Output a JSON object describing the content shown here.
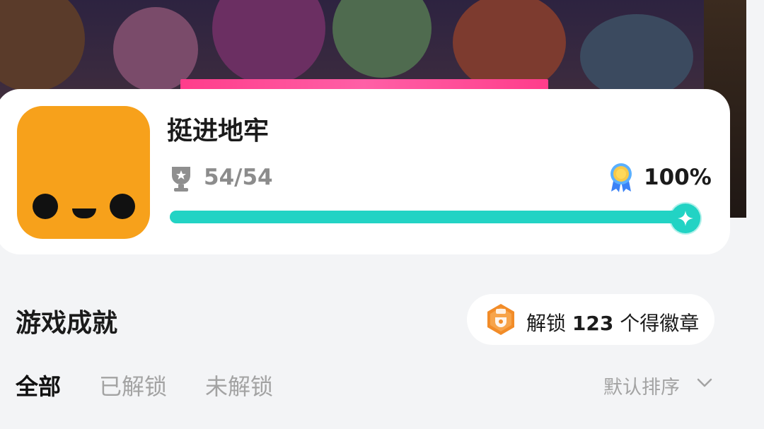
{
  "game": {
    "title": "挺进地牢",
    "achievements_progress": "54/54",
    "completion_percent": "100%",
    "completion_fraction": 1.0
  },
  "section": {
    "title": "游戏成就",
    "badge": {
      "prefix": "解锁",
      "count": "123",
      "suffix": "个得徽章"
    }
  },
  "tabs": [
    {
      "label": "全部",
      "active": true
    },
    {
      "label": "已解锁",
      "active": false
    },
    {
      "label": "未解锁",
      "active": false
    }
  ],
  "sort": {
    "label": "默认排序"
  },
  "colors": {
    "accent": "#22d3c4",
    "icon_bg": "#f7a11b",
    "badge_orange": "#f28c28"
  }
}
